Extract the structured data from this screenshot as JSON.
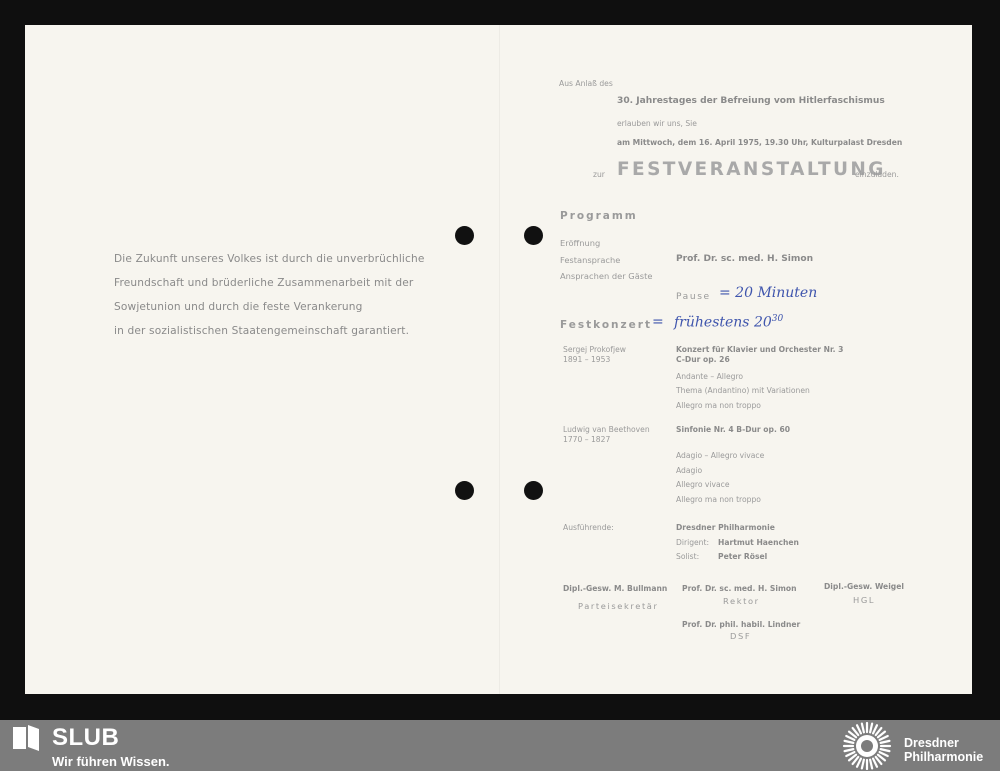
{
  "left_text": [
    "Die Zukunft unseres Volkes ist durch die unverbrüchliche",
    "Freundschaft und brüderliche Zusammenarbeit mit der",
    "Sowjetunion und durch die feste Verankerung",
    "in der sozialistischen Staatengemeinschaft garantiert."
  ],
  "invitation": {
    "occasion": "Aus Anlaß des",
    "event": "30. Jahrestages der Befreiung vom Hitlerfaschismus",
    "invite": "erlauben wir uns, Sie",
    "date_place": "am Mittwoch, dem 16. April 1975, 19.30 Uhr, Kulturpalast Dresden",
    "zur": "zur",
    "title": "FESTVERANSTALTUNG",
    "einzuladen": "einzuladen."
  },
  "programm": {
    "heading": "Programm",
    "items": [
      "Eröffnung",
      "Festansprache",
      "Ansprachen der Gäste"
    ],
    "speaker": "Prof. Dr. sc. med. H. Simon",
    "pause": "Pause"
  },
  "handwriting": {
    "pause": "= 20 Minuten",
    "konzert_prefix": "=",
    "konzert": "frühestens 20",
    "konzert_sup": "30"
  },
  "festkonzert": {
    "heading": "Festkonzert",
    "works": [
      {
        "composer": "Sergej Prokofjew",
        "years": "1891 – 1953",
        "title": "Konzert für Klavier und Orchester Nr. 3",
        "key": "C-Dur op. 26",
        "movements": [
          "Andante – Allegro",
          "Thema (Andantino) mit Variationen",
          "Allegro ma non troppo"
        ]
      },
      {
        "composer": "Ludwig van Beethoven",
        "years": "1770 – 1827",
        "title": "Sinfonie Nr. 4 B-Dur op. 60",
        "movements": [
          "Adagio – Allegro vivace",
          "Adagio",
          "Allegro vivace",
          "Allegro ma non troppo"
        ]
      }
    ]
  },
  "performers": {
    "label": "Ausführende:",
    "orchestra": "Dresdner Philharmonie",
    "conductor_label": "Dirigent:",
    "conductor": "Hartmut Haenchen",
    "soloist_label": "Solist:",
    "soloist": "Peter Rösel"
  },
  "signatories": [
    {
      "name": "Dipl.-Gesw. M. Bullmann",
      "role": "Parteisekretär"
    },
    {
      "name": "Prof. Dr. sc. med. H. Simon",
      "role": "Rektor"
    },
    {
      "name": "Dipl.-Gesw. Weigel",
      "role": "HGL"
    },
    {
      "name": "Prof. Dr. phil. habil. Lindner",
      "role": "DSF"
    }
  ],
  "footer": {
    "slub_title": "SLUB",
    "slub_tagline": "Wir führen Wissen.",
    "partner_line1": "Dresdner",
    "partner_line2": "Philharmonie",
    "slub_icon": "book-icon",
    "partner_icon": "sunburst-logo-icon"
  }
}
